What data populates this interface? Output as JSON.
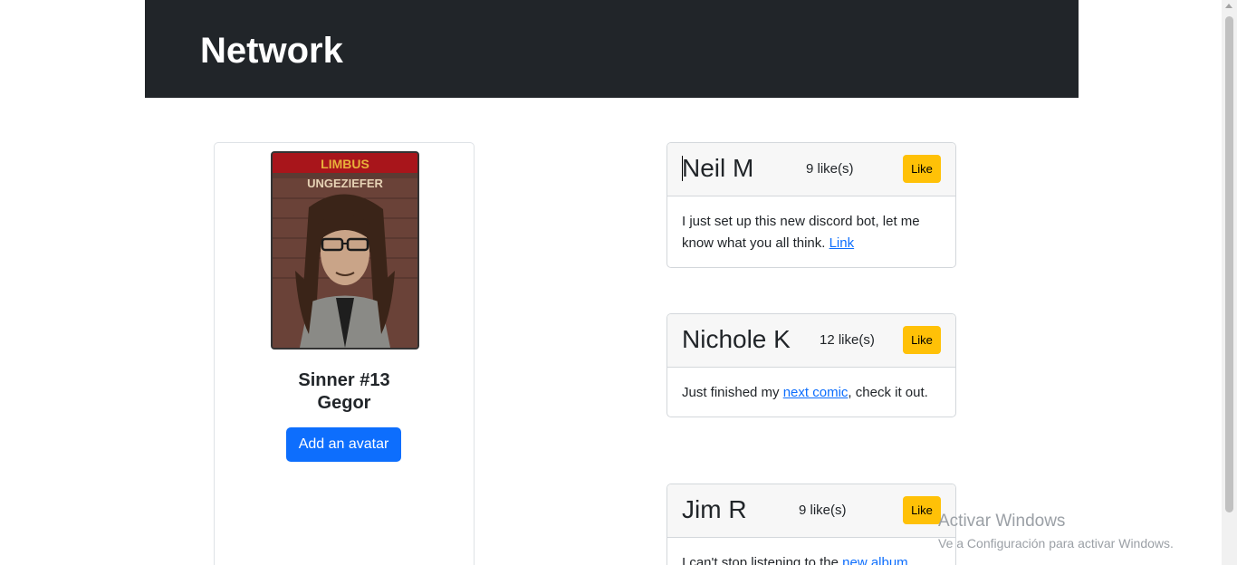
{
  "navbar": {
    "brand": "Network"
  },
  "profile": {
    "avatar_poster_title": "LIMBUS",
    "avatar_poster_subtitle": "UNGEZIEFER",
    "name_line1": "Sinner #13",
    "name_line2": "Gegor",
    "add_avatar_label": "Add an avatar"
  },
  "posts": [
    {
      "author": "Neil M",
      "likes": "9 like(s)",
      "like_label": "Like",
      "text_before": "I just set up this new discord bot, let me know what you all think. ",
      "link_text": "Link",
      "text_after": ""
    },
    {
      "author": "Nichole K",
      "likes": "12 like(s)",
      "like_label": "Like",
      "text_before": "Just finished my ",
      "link_text": "next comic",
      "text_after": ", check it out."
    },
    {
      "author": "Jim R",
      "likes": "9 like(s)",
      "like_label": "Like",
      "text_before": "I can't stop listening to the ",
      "link_text": "new album",
      "text_after": ""
    }
  ],
  "watermark": {
    "line1": "Activar Windows",
    "line2": "Ve a Configuración para activar Windows."
  },
  "colors": {
    "navbar_bg": "#212529",
    "primary": "#0d6efd",
    "warning": "#ffc107"
  }
}
